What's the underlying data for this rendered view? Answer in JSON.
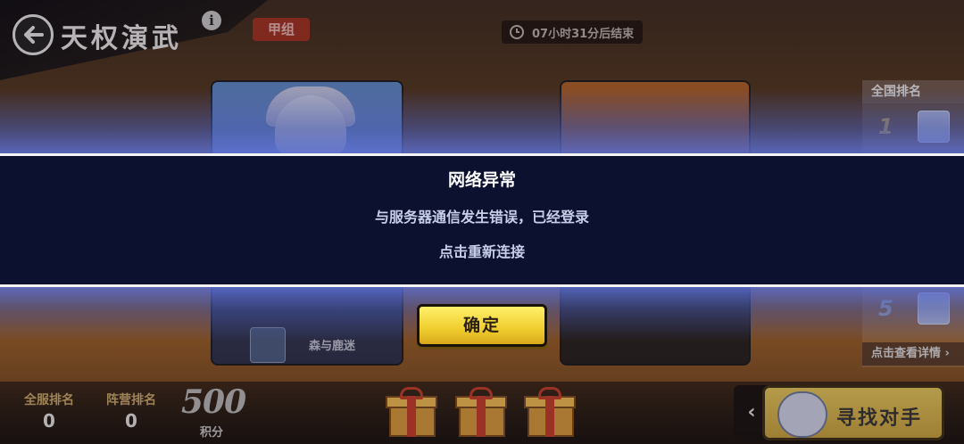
{
  "header": {
    "title": "天权演武",
    "group_badge": "甲组",
    "timer_text": "07小时31分后结束"
  },
  "cards": {
    "left_player_name": "森与鹿迷"
  },
  "ranking": {
    "header": "全国排名",
    "rows": [
      {
        "rank": "1"
      },
      {
        "rank": "5"
      }
    ],
    "detail_link": "点击查看详情"
  },
  "bottom": {
    "server_rank_label": "全服排名",
    "server_rank_value": "0",
    "camp_rank_label": "阵营排名",
    "camp_rank_value": "0",
    "score_value": "500",
    "score_label": "积分",
    "find_opponent_label": "寻找对手",
    "expand_arrow": "‹"
  },
  "dialog": {
    "title": "网络异常",
    "message": "与服务器通信发生错误，已经登录",
    "reconnect_text": "点击重新连接",
    "confirm_label": "确定"
  },
  "colors": {
    "dialog_bg": "#0d1130",
    "confirm_button": "#f0cd2e",
    "group_badge": "#a0301e"
  }
}
